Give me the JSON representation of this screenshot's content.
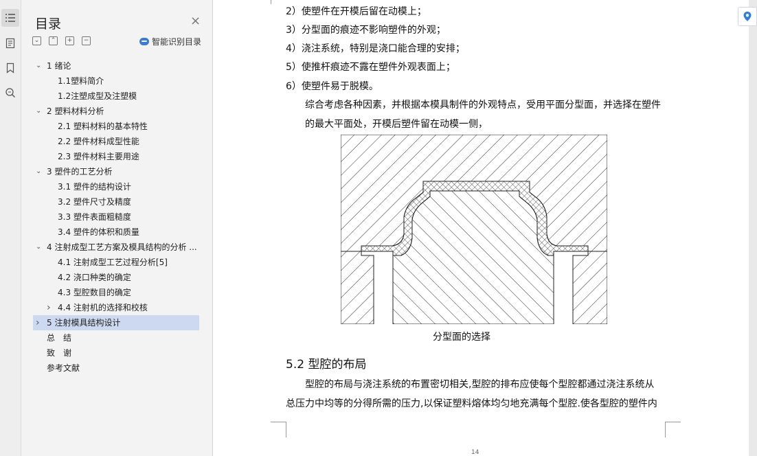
{
  "toc": {
    "title": "目录",
    "smart_label": "智能识别目录",
    "items": [
      {
        "label": "1 绪论",
        "chevron": "v"
      },
      {
        "label": "1.1塑料简介",
        "chevron": ""
      },
      {
        "label": "1.2注塑成型及注塑模",
        "chevron": ""
      },
      {
        "label": "2 塑料材料分析",
        "chevron": "v"
      },
      {
        "label": "2.1 塑料材料的基本特性",
        "chevron": ""
      },
      {
        "label": "2.2 塑件材料成型性能",
        "chevron": ""
      },
      {
        "label": "2.3 塑件材料主要用途",
        "chevron": ""
      },
      {
        "label": "3 塑件的工艺分析",
        "chevron": "v"
      },
      {
        "label": "3.1 塑件的结构设计",
        "chevron": ""
      },
      {
        "label": "3.2 塑件尺寸及精度",
        "chevron": ""
      },
      {
        "label": "3.3 塑件表面粗糙度",
        "chevron": ""
      },
      {
        "label": "3.4 塑件的体积和质量",
        "chevron": ""
      },
      {
        "label": "4 注射成型工艺方案及模具结构的分析 ...",
        "chevron": "v"
      },
      {
        "label": "4.1 注射成型工艺过程分析[5]",
        "chevron": ""
      },
      {
        "label": "4.2 浇口种类的确定",
        "chevron": ""
      },
      {
        "label": "4.3 型腔数目的确定",
        "chevron": ""
      },
      {
        "label": "4.4 注射机的选择和校核",
        "chevron": ">"
      },
      {
        "label": "5 注射模具结构设计",
        "chevron": ">"
      },
      {
        "label": "总　结",
        "chevron": ""
      },
      {
        "label": "致　谢",
        "chevron": ""
      },
      {
        "label": "参考文献",
        "chevron": ""
      }
    ]
  },
  "doc": {
    "list": [
      "2）使塑件在开模后留在动模上；",
      "3）分型面的痕迹不影响塑件的外观；",
      "4）浇注系统，特别是浇口能合理的安排；",
      "5）使推杆痕迹不露在塑件外观表面上；",
      "6）使塑件易于脱模。"
    ],
    "para1_line1": "综合考虑各种因素，并根据本模具制件的外观特点，受用平面分型面，并选择在塑件",
    "para1_line2": "的最大平面处，开模后塑件留在动模一侧，",
    "figure_caption": "分型面的选择",
    "section_heading": "5.2 型腔的布局",
    "para2_line1": "型腔的布局与浇注系统的布置密切相关,型腔的排布应使每个型腔都通过浇注系统从",
    "para2_line2": "总压力中均等的分得所需的压力,以保证塑料熔体均匀地充满每个型腔.使各型腔的塑件内",
    "page_number": "14"
  },
  "colors": {
    "selected_item": "#cdd9f0",
    "accent": "#3a7bd5"
  }
}
